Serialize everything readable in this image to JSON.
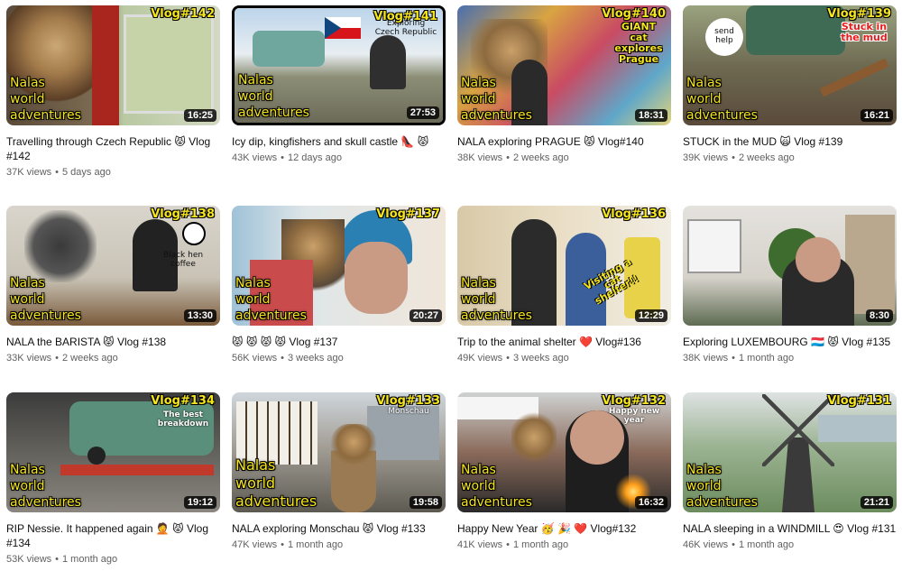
{
  "videos": [
    {
      "title": "Travelling through Czech Republic 😾 Vlog #142",
      "views": "37K views",
      "age": "5 days ago",
      "duration": "16:25",
      "tag": "Vlog#142",
      "brand": [
        "Nalas",
        "world",
        "adventures"
      ],
      "overlay": ""
    },
    {
      "title": "Icy dip, kingfishers and skull castle 👠 😾",
      "views": "43K views",
      "age": "12 days ago",
      "duration": "27:53",
      "tag": "Vlog#141",
      "brand": [
        "Nalas",
        "world",
        "adventures"
      ],
      "overlay": "Exploring Czech Republic"
    },
    {
      "title": "NALA exploring PRAGUE 😾 Vlog#140",
      "views": "38K views",
      "age": "2 weeks ago",
      "duration": "18:31",
      "tag": "Vlog#140",
      "brand": [
        "Nalas",
        "world",
        "adventures"
      ],
      "overlay": "GIANT cat explores Prague"
    },
    {
      "title": "STUCK in the MUD 🙀 Vlog #139",
      "views": "39K views",
      "age": "2 weeks ago",
      "duration": "16:21",
      "tag": "Vlog#139",
      "brand": [
        "Nalas",
        "world",
        "adventures"
      ],
      "overlay": "Stuck in the mud",
      "sticker": "send help"
    },
    {
      "title": "NALA the BARISTA 😾 Vlog #138",
      "views": "33K views",
      "age": "2 weeks ago",
      "duration": "13:30",
      "tag": "Vlog#138",
      "brand": [
        "Nalas",
        "world",
        "adventures"
      ],
      "overlay": "Black hen coffee"
    },
    {
      "title": "😾 😾 😾 😾 Vlog #137",
      "views": "56K views",
      "age": "3 weeks ago",
      "duration": "20:27",
      "tag": "Vlog#137",
      "brand": [
        "Nalas",
        "world",
        "adventures"
      ],
      "overlay": ""
    },
    {
      "title": "Trip to the animal shelter ❤️ Vlog#136",
      "views": "49K views",
      "age": "3 weeks ago",
      "duration": "12:29",
      "tag": "Vlog#136",
      "brand": [
        "Nalas",
        "world",
        "adventures"
      ],
      "overlay": "Visiting a cat shelter!!"
    },
    {
      "title": "Exploring LUXEMBOURG 🇱🇺 😾 Vlog #135",
      "views": "38K views",
      "age": "1 month ago",
      "duration": "8:30",
      "tag": "",
      "brand": [],
      "overlay": ""
    },
    {
      "title": "RIP Nessie. It happened again 🤦 😾 Vlog #134",
      "views": "53K views",
      "age": "1 month ago",
      "duration": "19:12",
      "tag": "Vlog#134",
      "brand": [
        "Nalas",
        "world",
        "adventures"
      ],
      "overlay": "The best breakdown"
    },
    {
      "title": "NALA exploring Monschau 😾 Vlog #133",
      "views": "47K views",
      "age": "1 month ago",
      "duration": "19:58",
      "tag": "Vlog#133",
      "brand": [
        "Nalas",
        "world",
        "adventures"
      ],
      "overlay": "Monschau"
    },
    {
      "title": "Happy New Year 🥳 🎉 ❤️ Vlog#132",
      "views": "41K views",
      "age": "1 month ago",
      "duration": "16:32",
      "tag": "Vlog#132",
      "brand": [
        "Nalas",
        "world",
        "adventures"
      ],
      "overlay": "Happy new year"
    },
    {
      "title": "NALA sleeping in a WINDMILL 😍 Vlog #131",
      "views": "46K views",
      "age": "1 month ago",
      "duration": "21:21",
      "tag": "Vlog#131",
      "brand": [
        "Nalas",
        "world",
        "adventures"
      ],
      "overlay": ""
    }
  ],
  "colors": {
    "tag": "#f5e51c",
    "meta": "#606060",
    "title": "#0f0f0f"
  }
}
